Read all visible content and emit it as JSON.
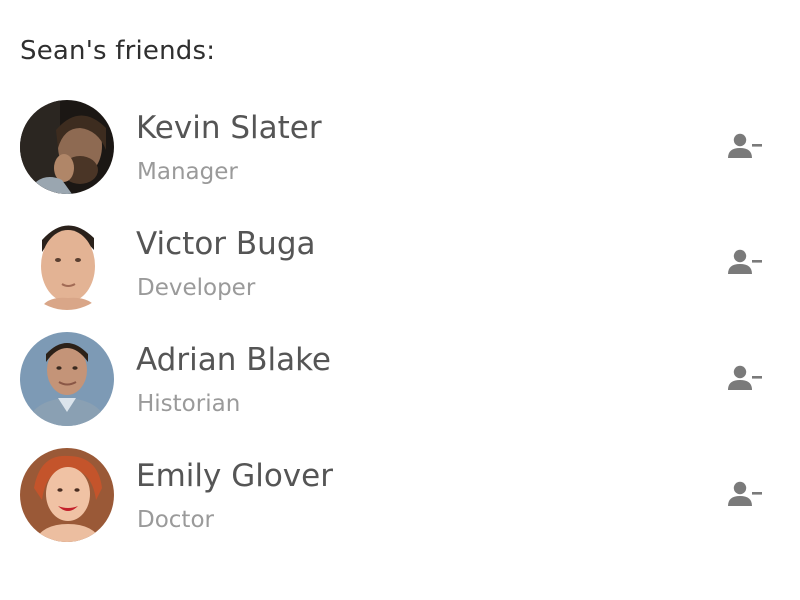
{
  "header": {
    "title": "Sean's friends:"
  },
  "friends": [
    {
      "name": "Kevin Slater",
      "role": "Manager",
      "avatar_tone": "#3a3530",
      "action_icon": "person-minus-icon"
    },
    {
      "name": "Victor Buga",
      "role": "Developer",
      "avatar_tone": "#e9c3a8",
      "action_icon": "person-minus-icon"
    },
    {
      "name": "Adrian Blake",
      "role": "Historian",
      "avatar_tone": "#7c98b3",
      "action_icon": "person-minus-icon"
    },
    {
      "name": "Emily Glover",
      "role": "Doctor",
      "avatar_tone": "#9b5a3a",
      "action_icon": "person-minus-icon"
    }
  ],
  "colors": {
    "heading": "#2f2f2f",
    "name": "#555555",
    "role": "#9a9a9a",
    "icon": "#7a7a7a"
  }
}
